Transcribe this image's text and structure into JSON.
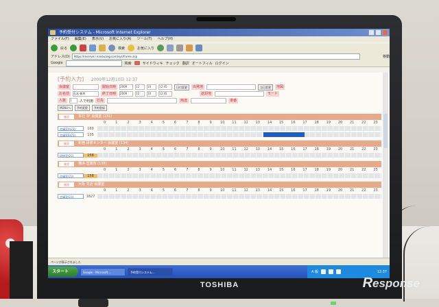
{
  "window": {
    "title": "予約受付システム - Microsoft Internet Explorer",
    "menu": [
      "ファイル(F)",
      "編集(E)",
      "表示(V)",
      "お気に入り(A)",
      "ツール(T)",
      "ヘルプ(H)"
    ],
    "toolbar_labels": [
      "戻る",
      "検索",
      "お気に入り"
    ],
    "address_label": "アドレス(D)",
    "address": "https://reserve.l.nanbuang.com/sys/frame.asp",
    "go_label": "移動",
    "google_bar": [
      "Google",
      "検索",
      "サイドウィキ",
      "チェック",
      "翻訳",
      "オートフィル",
      "ログイン"
    ]
  },
  "page": {
    "heading": "[予約入力]",
    "date": "2009年12月10日 12:37",
    "form": {
      "row1": [
        "会議室",
        "開始日時",
        "出発地",
        "当日変更",
        "地図"
      ],
      "row2": [
        "お名前",
        "終了日時",
        "返却地",
        "モード"
      ],
      "row3": [
        "人数",
        "人で利用",
        "行先",
        "用途",
        "車番"
      ],
      "row4": [
        "MENUへ",
        "予約変更",
        "予約登録"
      ],
      "start_year": "2009",
      "start_month": "12",
      "start_day": "10",
      "start_time": "12:45",
      "end_year": "2009",
      "end_month": "12",
      "end_day": "10",
      "end_time": "12:45",
      "date_change_button": "日付変更",
      "name_value": "石本 敏幸",
      "persons_value": "1"
    },
    "hours": [
      "0",
      "1",
      "2",
      "3",
      "4",
      "5",
      "6",
      "7",
      "8",
      "9",
      "10",
      "11",
      "12",
      "13",
      "14",
      "15",
      "16",
      "17",
      "18",
      "19",
      "20",
      "21",
      "22",
      "23"
    ],
    "sections": [
      {
        "tag": "施設",
        "name": "本社 3F 会議室 (131)",
        "rows": [
          {
            "label": "会議室A(23)",
            "capacity": "160",
            "highlight": false
          },
          {
            "label": "会議室B(23)",
            "capacity": "135",
            "highlight": false,
            "booking_start_hour": 14,
            "booking_end_hour": 17.5
          }
        ]
      },
      {
        "tag": "施設",
        "name": "新宿 研修センター 会議室 (134)",
        "rows": [
          {
            "label": "研修室(23)",
            "capacity": "158",
            "highlight": true
          }
        ]
      },
      {
        "tag": "施設",
        "name": "横浜 営業所 (135)",
        "rows": [
          {
            "label": "会議室(23)",
            "capacity": "158",
            "highlight": true
          }
        ]
      },
      {
        "tag": "施設",
        "name": "大阪 支店 会議室",
        "rows": [
          {
            "label": "会議室(23)",
            "capacity": "1827",
            "highlight": false
          }
        ]
      }
    ],
    "status": "ページが表示されました"
  },
  "taskbar": {
    "start": "スタート",
    "tasks": [
      "Google - Microsoft...",
      "予約受付システム..."
    ],
    "ime": "A 般",
    "clock": "12:37"
  },
  "device": {
    "brand": "TOSHIBA"
  },
  "watermark": {
    "text": "esponse",
    "mark": "R"
  },
  "colors": {
    "section_header": "#e7a98a",
    "booking": "#1f5ec4",
    "titlebar": "#2b4ea0",
    "taskbar": "#2551b8"
  }
}
